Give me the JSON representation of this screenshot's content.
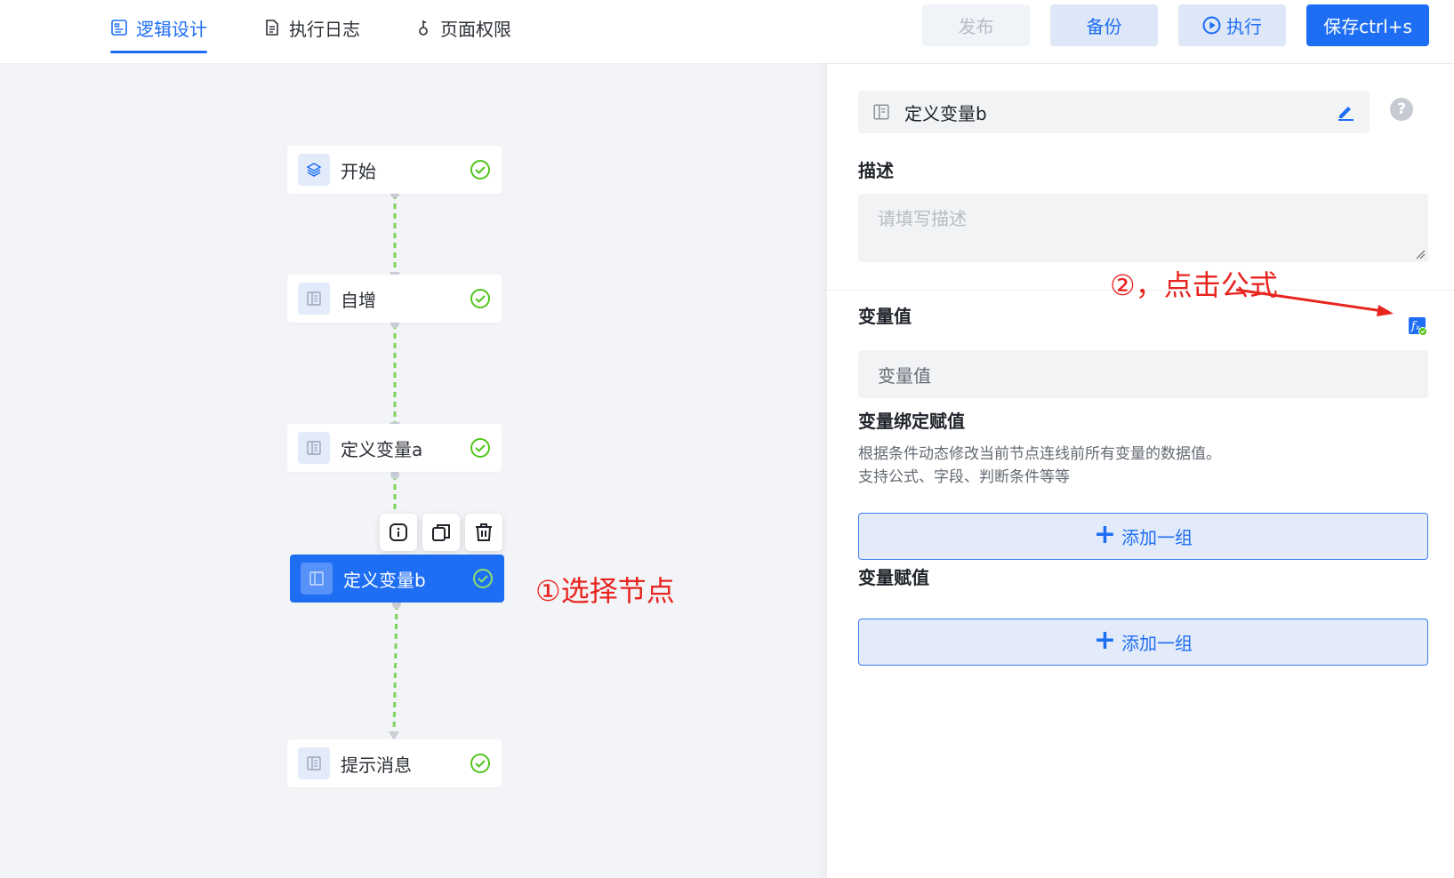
{
  "tabs": [
    {
      "label": "逻辑设计",
      "icon": "design-icon",
      "active": true
    },
    {
      "label": "执行日志",
      "icon": "document-icon",
      "active": false
    },
    {
      "label": "页面权限",
      "icon": "key-icon",
      "active": false
    }
  ],
  "toolbar": {
    "publish_label": "发布",
    "backup_label": "备份",
    "run_label": "执行",
    "save_label": "保存ctrl+s"
  },
  "flow": {
    "nodes": [
      {
        "label": "开始",
        "icon": "layers-icon",
        "status": "success"
      },
      {
        "label": "自增",
        "icon": "node-icon",
        "status": "success"
      },
      {
        "label": "定义变量a",
        "icon": "node-icon",
        "status": "success"
      },
      {
        "label": "定义变量b",
        "icon": "node-icon",
        "status": "success",
        "selected": true
      },
      {
        "label": "提示消息",
        "icon": "node-icon",
        "status": "success"
      }
    ],
    "node_tools": [
      "info-icon",
      "copy-icon",
      "trash-icon"
    ],
    "annotation": "①选择节点"
  },
  "panel": {
    "node_name": "定义变量b",
    "description_label": "描述",
    "description_placeholder": "请填写描述",
    "annotation": "②，点击公式",
    "variable_value_label": "变量值",
    "variable_value_placeholder": "变量值",
    "binding_label": "变量绑定赋值",
    "binding_hint_line1": "根据条件动态修改当前节点连线前所有变量的数据值。",
    "binding_hint_line2": "支持公式、字段、判断条件等等",
    "add_group_label": "添加一组",
    "assign_label": "变量赋值",
    "add_group_label_2": "添加一组"
  },
  "colors": {
    "primary": "#1e6ef4",
    "success": "#52c41a",
    "connector": "#7dd35a",
    "annotation": "#e8241f"
  }
}
